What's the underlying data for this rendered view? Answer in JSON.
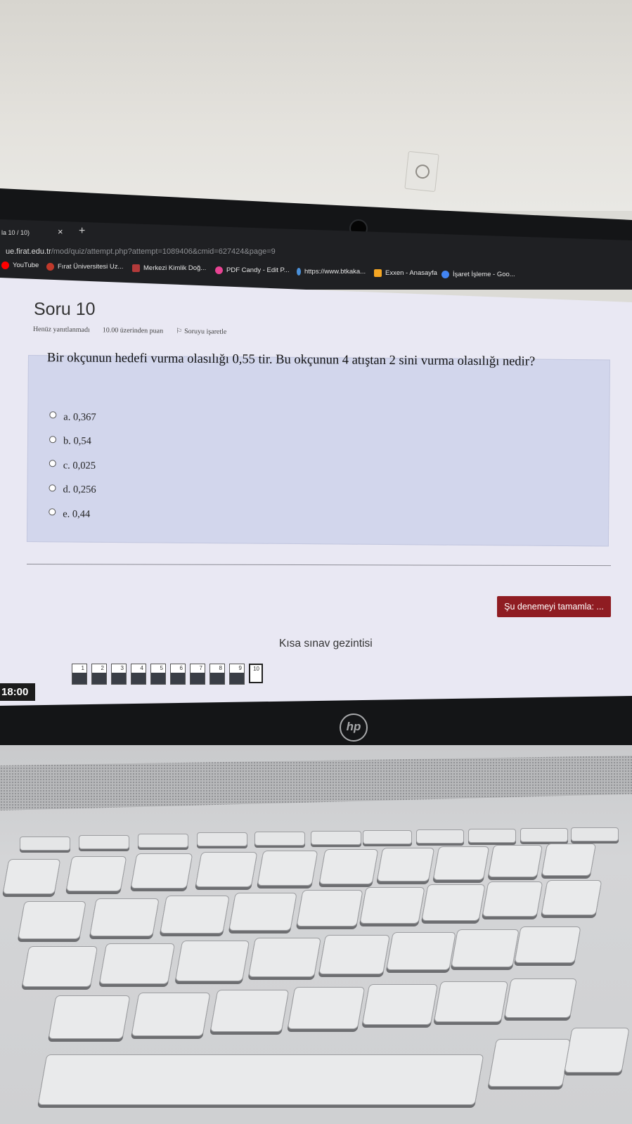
{
  "browser": {
    "tab_title": "la 10 / 10)",
    "tab_close": "×",
    "new_tab": "+",
    "address_host": "ue.firat.edu.tr",
    "address_path": "/mod/quiz/attempt.php?attempt=1089406&cmid=627424&page=9",
    "bookmarks": [
      {
        "label": "YouTube",
        "color": "#ff0000"
      },
      {
        "label": "Fırat Üniversitesi Uz...",
        "color": "#c0392b"
      },
      {
        "label": "Merkezi Kimlik Doğ...",
        "color": "#b33a3a"
      },
      {
        "label": "PDF Candy - Edit P...",
        "color": "#e84393"
      },
      {
        "label": "https://www.btkaka...",
        "color": "#4a90d9"
      },
      {
        "label": "Exxen - Anasayfa",
        "color": "#f5a623"
      },
      {
        "label": "İşaret İşleme - Goo...",
        "color": "#4285f4"
      }
    ]
  },
  "quiz": {
    "title": "Soru 10",
    "status": "Henüz yanıtlanmadı",
    "points": "10.00 üzerinden puan",
    "flag_label": "Soruyu işaretle",
    "question": "Bir okçunun hedefi vurma olasılığı 0,55 tir. Bu okçunun 4 atıştan 2 sini vurma olasılığı nedir?",
    "answers": [
      {
        "label": "a. 0,367"
      },
      {
        "label": "b. 0,54"
      },
      {
        "label": "c. 0,025"
      },
      {
        "label": "d. 0,256"
      },
      {
        "label": "e. 0,44"
      }
    ],
    "finish_button": "Şu denemeyi tamamla: ...",
    "nav_title": "Kısa sınav gezintisi",
    "nav_pages": [
      "1",
      "2",
      "3",
      "4",
      "5",
      "6",
      "7",
      "8",
      "9",
      "10"
    ],
    "current_page": "10"
  },
  "taskbar": {
    "clock": "18:00"
  },
  "laptop": {
    "brand": "hp"
  }
}
